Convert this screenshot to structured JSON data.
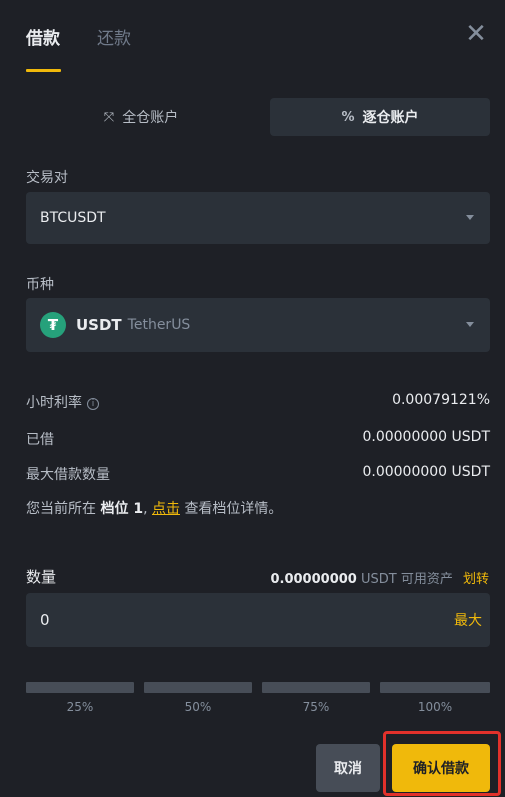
{
  "tabs": {
    "active": "借款",
    "inactive": "还款"
  },
  "close_icon": "close-icon",
  "modes": {
    "cross": {
      "icon": "⤧",
      "label": "全仓账户"
    },
    "isolated": {
      "icon": "%",
      "label": "逐仓账户"
    }
  },
  "pair": {
    "label": "交易对",
    "value": "BTCUSDT"
  },
  "coin": {
    "label": "币种",
    "logo": "₮",
    "code": "USDT",
    "name": "TetherUS"
  },
  "stats": {
    "hourly_rate": {
      "label": "小时利率",
      "value": "0.00079121%"
    },
    "borrowed": {
      "label": "已借",
      "value": "0.00000000 USDT"
    },
    "max_borrow": {
      "label": "最大借款数量",
      "value": "0.00000000 USDT"
    }
  },
  "tier": {
    "prefix": "您当前所在",
    "tier_label": "档位 1",
    "comma": ",",
    "link": "点击",
    "suffix": "查看档位详情。"
  },
  "quantity": {
    "label": "数量",
    "available_amount": "0.00000000",
    "available_unit": "USDT 可用资产",
    "transfer": "划转",
    "value": "0",
    "max": "最大",
    "percents": [
      "25%",
      "50%",
      "75%",
      "100%"
    ]
  },
  "buttons": {
    "cancel": "取消",
    "confirm": "确认借款"
  },
  "colors": {
    "accent": "#f0b90b",
    "background": "#1e2026",
    "highlight_border": "#e2312b"
  }
}
